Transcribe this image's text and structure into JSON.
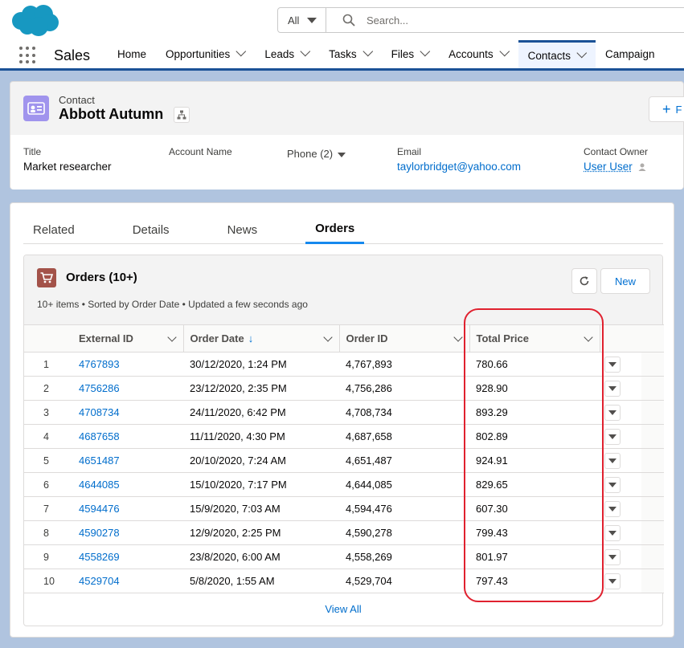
{
  "header": {
    "search_scope": "All",
    "search_placeholder": "Search...",
    "app_name": "Sales",
    "nav": [
      {
        "label": "Home",
        "chevron": false
      },
      {
        "label": "Opportunities",
        "chevron": true
      },
      {
        "label": "Leads",
        "chevron": true
      },
      {
        "label": "Tasks",
        "chevron": true
      },
      {
        "label": "Files",
        "chevron": true
      },
      {
        "label": "Accounts",
        "chevron": true
      },
      {
        "label": "Contacts",
        "chevron": true,
        "active": true
      },
      {
        "label": "Campaign",
        "chevron": false
      }
    ]
  },
  "record": {
    "type": "Contact",
    "name": "Abbott Autumn",
    "follow_label": "F",
    "fields": {
      "title_label": "Title",
      "title_value": "Market researcher",
      "account_label": "Account Name",
      "phone_label": "Phone (2)",
      "email_label": "Email",
      "email_value": "taylorbridget@yahoo.com",
      "owner_label": "Contact Owner",
      "owner_value": "User User"
    }
  },
  "tabs": [
    "Related",
    "Details",
    "News",
    "Orders"
  ],
  "active_tab": "Orders",
  "orders": {
    "title": "Orders (10+)",
    "subtitle": "10+ items • Sorted by Order Date • Updated a few seconds ago",
    "new_label": "New",
    "view_all": "View All",
    "columns": [
      "External ID",
      "Order Date",
      "Order ID",
      "Total Price"
    ],
    "rows": [
      {
        "n": "1",
        "ext": "4767893",
        "date": "30/12/2020, 1:24 PM",
        "oid": "4,767,893",
        "price": "780.66"
      },
      {
        "n": "2",
        "ext": "4756286",
        "date": "23/12/2020, 2:35 PM",
        "oid": "4,756,286",
        "price": "928.90"
      },
      {
        "n": "3",
        "ext": "4708734",
        "date": "24/11/2020, 6:42 PM",
        "oid": "4,708,734",
        "price": "893.29"
      },
      {
        "n": "4",
        "ext": "4687658",
        "date": "11/11/2020, 4:30 PM",
        "oid": "4,687,658",
        "price": "802.89"
      },
      {
        "n": "5",
        "ext": "4651487",
        "date": "20/10/2020, 7:24 AM",
        "oid": "4,651,487",
        "price": "924.91"
      },
      {
        "n": "6",
        "ext": "4644085",
        "date": "15/10/2020, 7:17 PM",
        "oid": "4,644,085",
        "price": "829.65"
      },
      {
        "n": "7",
        "ext": "4594476",
        "date": "15/9/2020, 7:03 AM",
        "oid": "4,594,476",
        "price": "607.30"
      },
      {
        "n": "8",
        "ext": "4590278",
        "date": "12/9/2020, 2:25 PM",
        "oid": "4,590,278",
        "price": "799.43"
      },
      {
        "n": "9",
        "ext": "4558269",
        "date": "23/8/2020, 6:00 AM",
        "oid": "4,558,269",
        "price": "801.97"
      },
      {
        "n": "10",
        "ext": "4529704",
        "date": "5/8/2020, 1:55 AM",
        "oid": "4,529,704",
        "price": "797.43"
      }
    ]
  },
  "colors": {
    "accent": "#1b5297",
    "link": "#006dcc",
    "highlight": "#e0212f"
  }
}
